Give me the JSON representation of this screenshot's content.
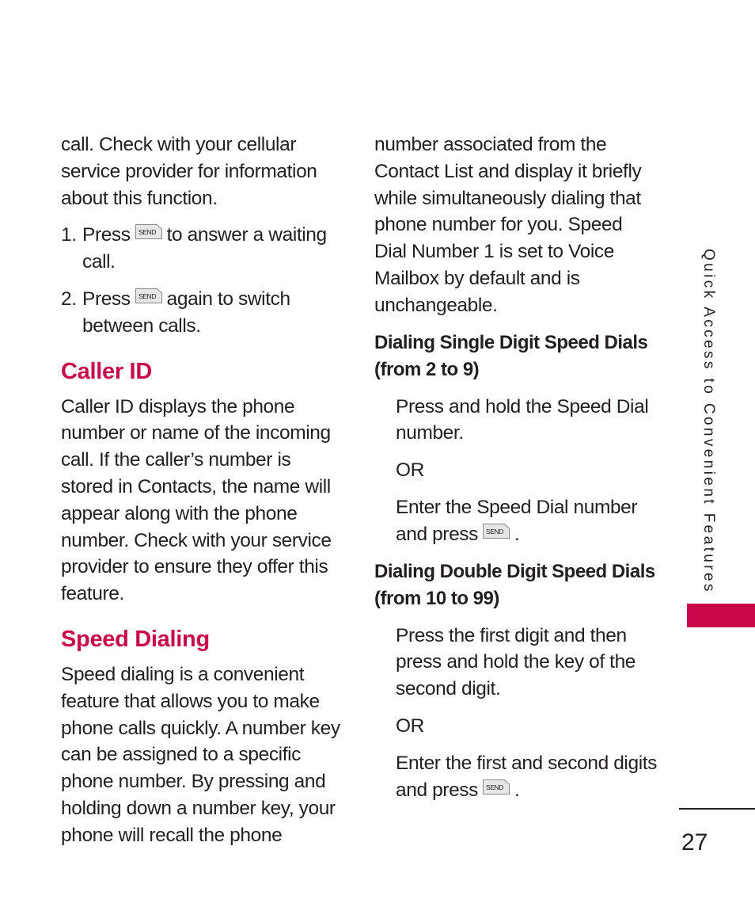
{
  "left_column": {
    "intro": "call. Check with your cellular service provider for information about this function.",
    "steps": [
      {
        "num": "1.",
        "before": "Press",
        "key": "SEND",
        "after": "to answer a waiting call."
      },
      {
        "num": "2.",
        "before": "Press",
        "key": "SEND",
        "after": "again to switch between calls."
      }
    ],
    "caller_id": {
      "heading": "Caller ID",
      "body": "Caller ID displays the phone number or name of the incoming call. If the caller’s number is stored in Contacts, the name will appear along with the phone number. Check with your service provider to ensure they offer this feature."
    },
    "speed_dialing": {
      "heading": "Speed Dialing",
      "body": "Speed dialing is a convenient feature that allows you to make phone calls quickly. A number key can be assigned to a specific phone number. By pressing and holding down a number key, your phone will recall the phone"
    }
  },
  "right_column": {
    "intro": "number associated from the Contact List and display it briefly while simultaneously dialing that phone number for you. Speed Dial Number 1 is set to Voice Mailbox by default and is unchangeable.",
    "single_digit": {
      "heading": "Dialing Single Digit Speed Dials (from 2 to 9)",
      "step1": "Press and hold the Speed Dial number.",
      "or": "OR",
      "step2_before": "Enter the Speed Dial number and press",
      "key": "SEND",
      "step2_after": "."
    },
    "double_digit": {
      "heading": "Dialing Double Digit Speed Dials (from 10 to 99)",
      "step1": "Press the first digit and then press and hold the key of the second digit.",
      "or": "OR",
      "step2_before": "Enter the first and second digits and press",
      "key": "SEND",
      "step2_after": "."
    }
  },
  "side_tab": {
    "label": "Quick Access to Convenient Features",
    "accent_color": "#c8084a"
  },
  "footer": {
    "page_number": "27"
  }
}
